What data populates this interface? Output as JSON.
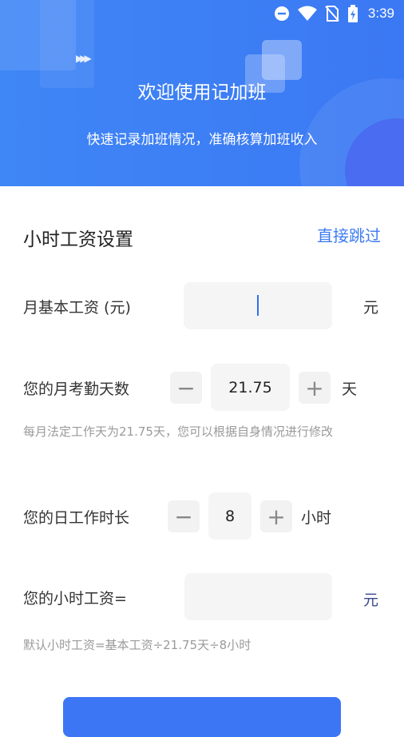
{
  "status_bar": {
    "time": "3:39",
    "icons": [
      "do-not-disturb-icon",
      "wifi-icon",
      "no-sim-icon",
      "battery-charging-icon"
    ]
  },
  "header": {
    "title": "欢迎使用记加班",
    "subtitle": "快速记录加班情况，准确核算加班收入"
  },
  "section": {
    "title": "小时工资设置",
    "skip_label": "直接跳过"
  },
  "base_salary": {
    "label": "月基本工资 (元)",
    "value": "",
    "unit": "元"
  },
  "attendance_days": {
    "label": "您的月考勤天数",
    "value": "21.75",
    "unit": "天",
    "hint": "每月法定工作天为21.75天，您可以根据自身情况进行修改",
    "minus": "−",
    "plus": "+"
  },
  "work_hours": {
    "label": "您的日工作时长",
    "value": "8",
    "unit": "小时",
    "minus": "−",
    "plus": "+"
  },
  "hourly_wage": {
    "label": "您的小时工资=",
    "value": "",
    "unit": "元",
    "hint": "默认小时工资=基本工资÷21.75天÷8小时"
  },
  "colors": {
    "accent": "#3d7cf4",
    "header": "#3f86f6"
  }
}
